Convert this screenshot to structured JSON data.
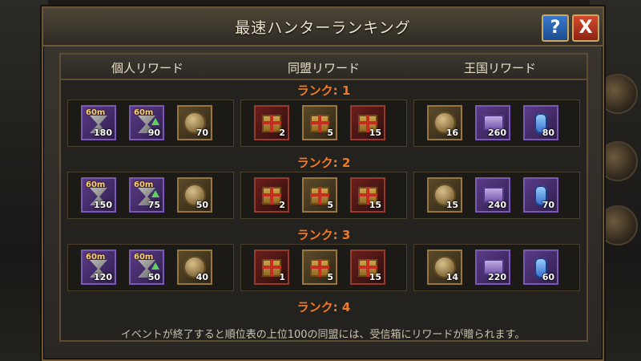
{
  "window": {
    "title": "最速ハンターランキング",
    "help_label": "?",
    "close_label": "X"
  },
  "tabs": [
    {
      "label": "個人リワード"
    },
    {
      "label": "同盟リワード"
    },
    {
      "label": "王国リワード"
    }
  ],
  "ranks": [
    {
      "label": "ランク: 1",
      "personal": [
        {
          "icon": "speedup-hourglass-icon",
          "tag": "60m",
          "count": "180"
        },
        {
          "icon": "speedup-hourglass-up-icon",
          "tag": "60m",
          "count": "90"
        },
        {
          "icon": "gold-coin-icon",
          "count": "70"
        }
      ],
      "alliance": [
        {
          "icon": "gift-box-icon",
          "count": "2"
        },
        {
          "icon": "gift-box-icon",
          "count": "5"
        },
        {
          "icon": "gift-box-icon",
          "count": "15"
        }
      ],
      "kingdom": [
        {
          "icon": "gold-coin-icon",
          "count": "16"
        },
        {
          "icon": "treasure-chest-icon",
          "count": "260"
        },
        {
          "icon": "potion-icon",
          "count": "80"
        }
      ]
    },
    {
      "label": "ランク: 2",
      "personal": [
        {
          "icon": "speedup-hourglass-icon",
          "tag": "60m",
          "count": "150"
        },
        {
          "icon": "speedup-hourglass-up-icon",
          "tag": "60m",
          "count": "75"
        },
        {
          "icon": "gold-coin-icon",
          "count": "50"
        }
      ],
      "alliance": [
        {
          "icon": "gift-box-icon",
          "count": "2"
        },
        {
          "icon": "gift-box-icon",
          "count": "5"
        },
        {
          "icon": "gift-box-icon",
          "count": "15"
        }
      ],
      "kingdom": [
        {
          "icon": "gold-coin-icon",
          "count": "15"
        },
        {
          "icon": "treasure-chest-icon",
          "count": "240"
        },
        {
          "icon": "potion-icon",
          "count": "70"
        }
      ]
    },
    {
      "label": "ランク: 3",
      "personal": [
        {
          "icon": "speedup-hourglass-icon",
          "tag": "60m",
          "count": "120"
        },
        {
          "icon": "speedup-hourglass-up-icon",
          "tag": "60m",
          "count": "50"
        },
        {
          "icon": "gold-coin-icon",
          "count": "40"
        }
      ],
      "alliance": [
        {
          "icon": "gift-box-icon",
          "count": "1"
        },
        {
          "icon": "gift-box-icon",
          "count": "5"
        },
        {
          "icon": "gift-box-icon",
          "count": "15"
        }
      ],
      "kingdom": [
        {
          "icon": "gold-coin-icon",
          "count": "14"
        },
        {
          "icon": "treasure-chest-icon",
          "count": "220"
        },
        {
          "icon": "potion-icon",
          "count": "60"
        }
      ]
    },
    {
      "label": "ランク: 4"
    }
  ],
  "footer": "イベントが終了すると順位表の上位100の同盟には、受信箱にリワードが贈られます。",
  "colors": {
    "rank_label": "#f07a2a",
    "frame_gold": "#6b5737"
  }
}
